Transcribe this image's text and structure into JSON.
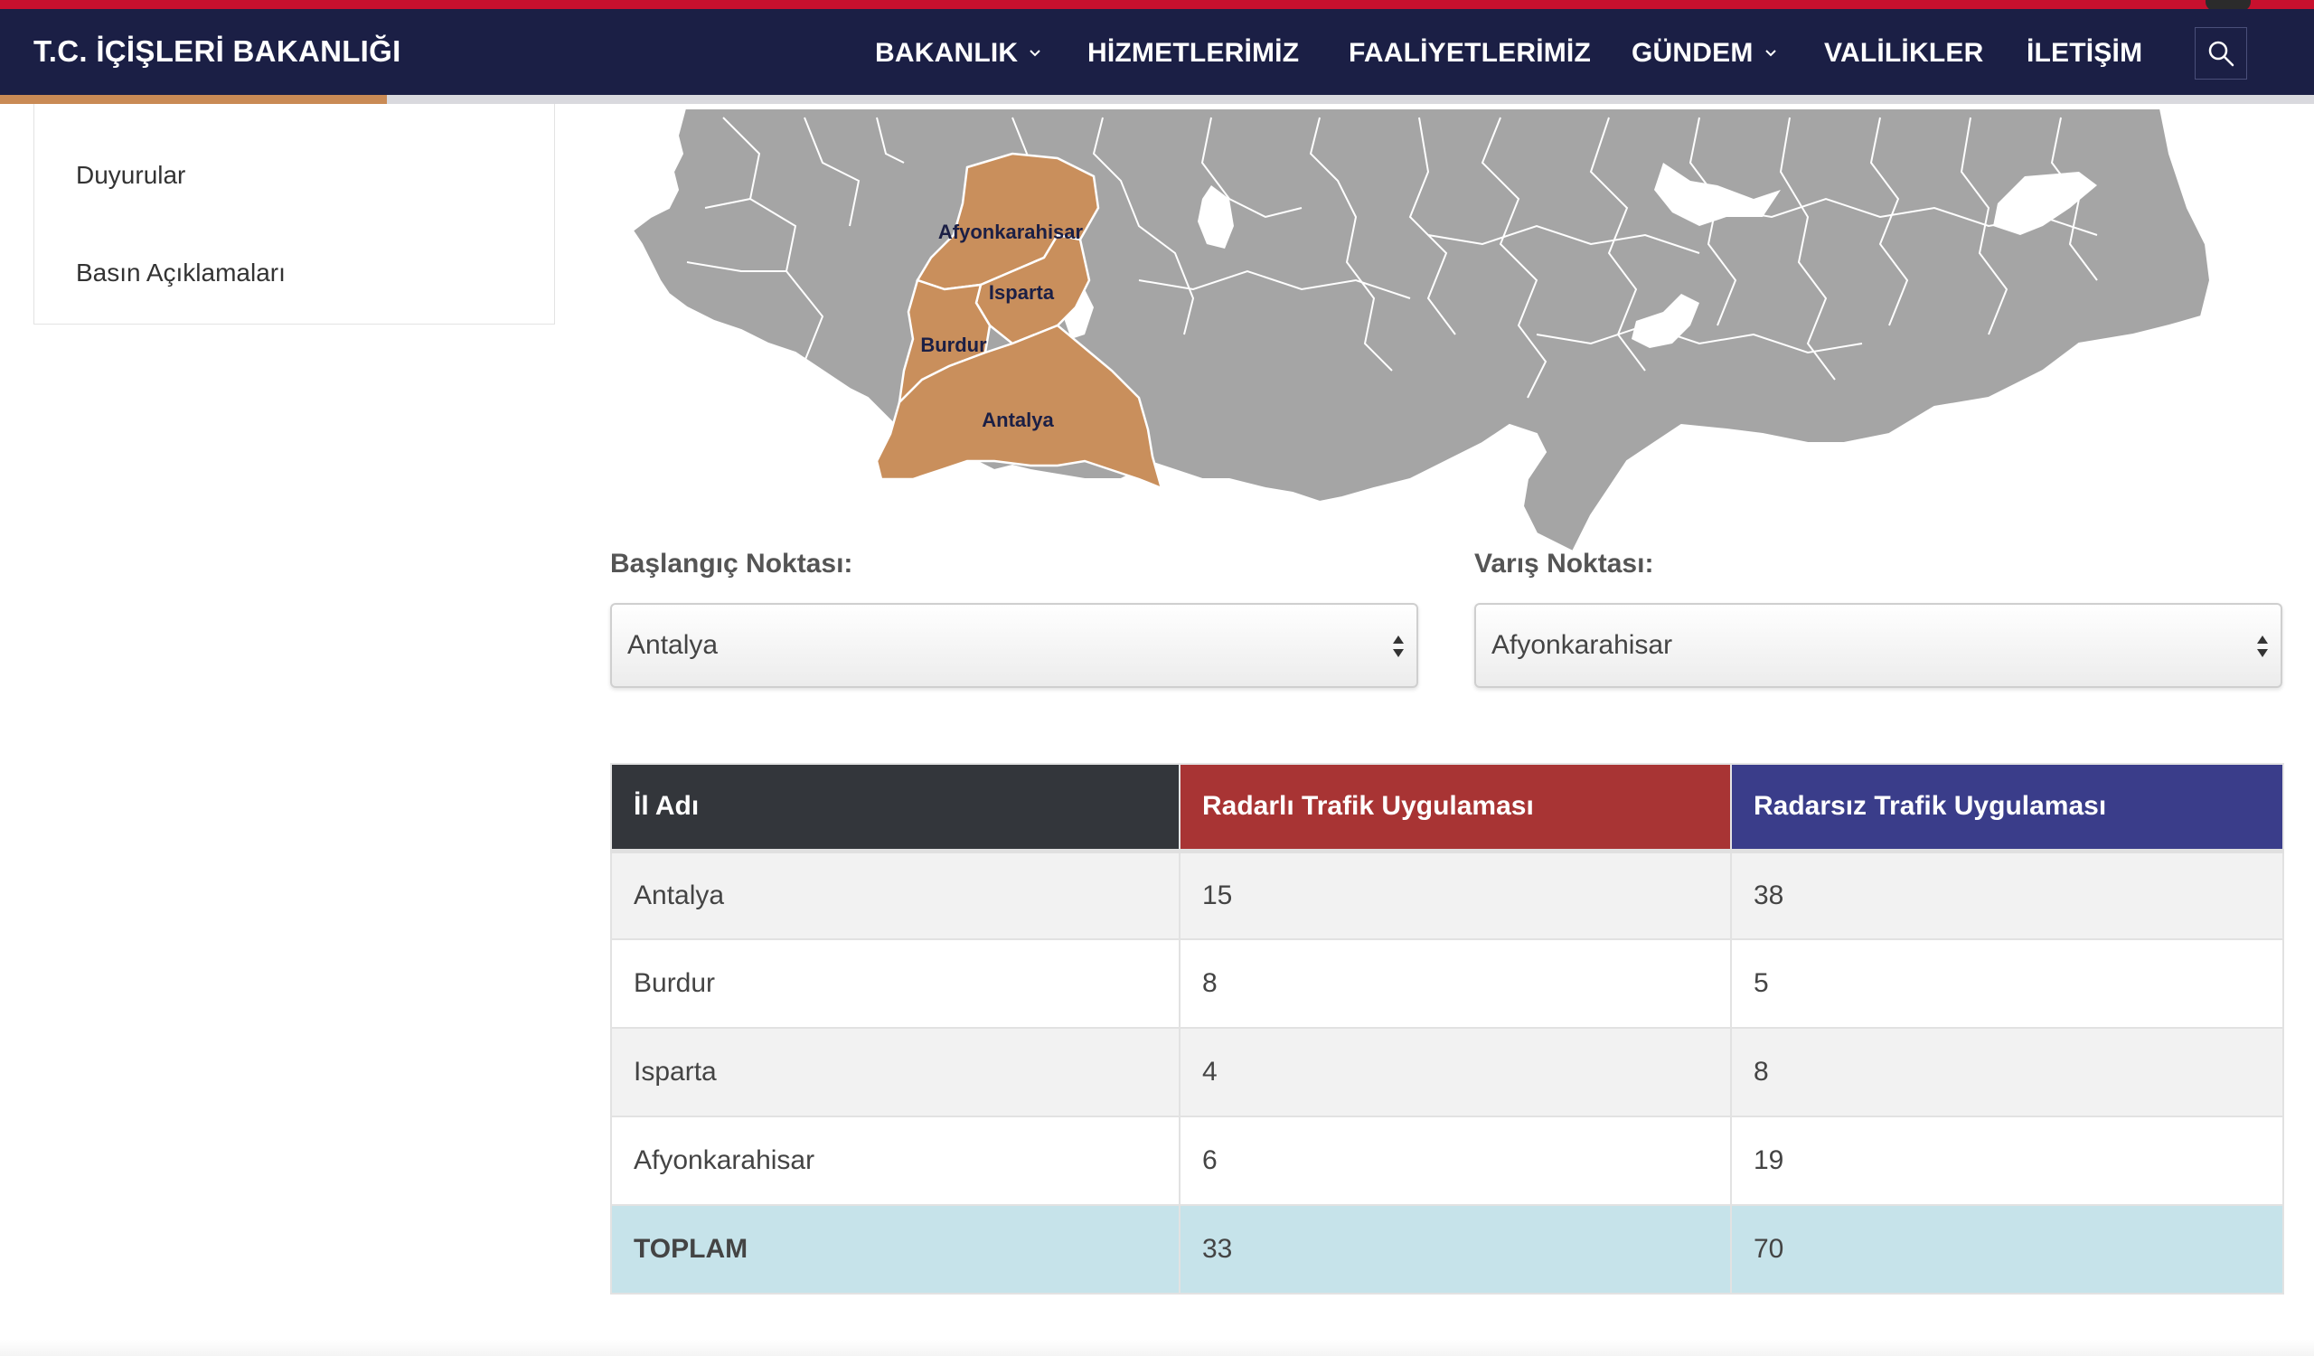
{
  "header": {
    "brand": "T.C. İÇİŞLERİ BAKANLIĞI",
    "nav": [
      {
        "label": "BAKANLIK",
        "has_dropdown": true
      },
      {
        "label": "HİZMETLERİMİZ",
        "has_dropdown": false
      },
      {
        "label": "FAALİYETLERİMİZ",
        "has_dropdown": false
      },
      {
        "label": "GÜNDEM",
        "has_dropdown": true
      },
      {
        "label": "VALİLİKLER",
        "has_dropdown": false
      },
      {
        "label": "İLETİŞİM",
        "has_dropdown": false
      }
    ],
    "search_icon": "search-icon"
  },
  "sidebar": {
    "items": [
      {
        "label": "Duyurular"
      },
      {
        "label": "Basın Açıklamaları"
      }
    ]
  },
  "map": {
    "highlight_color": "#c98f5c",
    "base_color": "#a5a5a5",
    "highlighted_provinces": [
      {
        "label": "Afyonkarahisar"
      },
      {
        "label": "Isparta"
      },
      {
        "label": "Burdur"
      },
      {
        "label": "Antalya"
      }
    ]
  },
  "route": {
    "start_label": "Başlangıç Noktası:",
    "start_value": "Antalya",
    "end_label": "Varış Noktası:",
    "end_value": "Afyonkarahisar"
  },
  "table": {
    "headers": [
      {
        "label": "İl Adı",
        "color": "#33363b"
      },
      {
        "label": "Radarlı Trafik Uygulaması",
        "color": "#a83434"
      },
      {
        "label": "Radarsız Trafik Uygulaması",
        "color": "#3a3d8a"
      }
    ],
    "rows": [
      {
        "name": "Antalya",
        "radar": "15",
        "no_radar": "38"
      },
      {
        "name": "Burdur",
        "radar": "8",
        "no_radar": "5"
      },
      {
        "name": "Isparta",
        "radar": "4",
        "no_radar": "8"
      },
      {
        "name": "Afyonkarahisar",
        "radar": "6",
        "no_radar": "19"
      }
    ],
    "total": {
      "name": "TOPLAM",
      "radar": "33",
      "no_radar": "70"
    }
  }
}
